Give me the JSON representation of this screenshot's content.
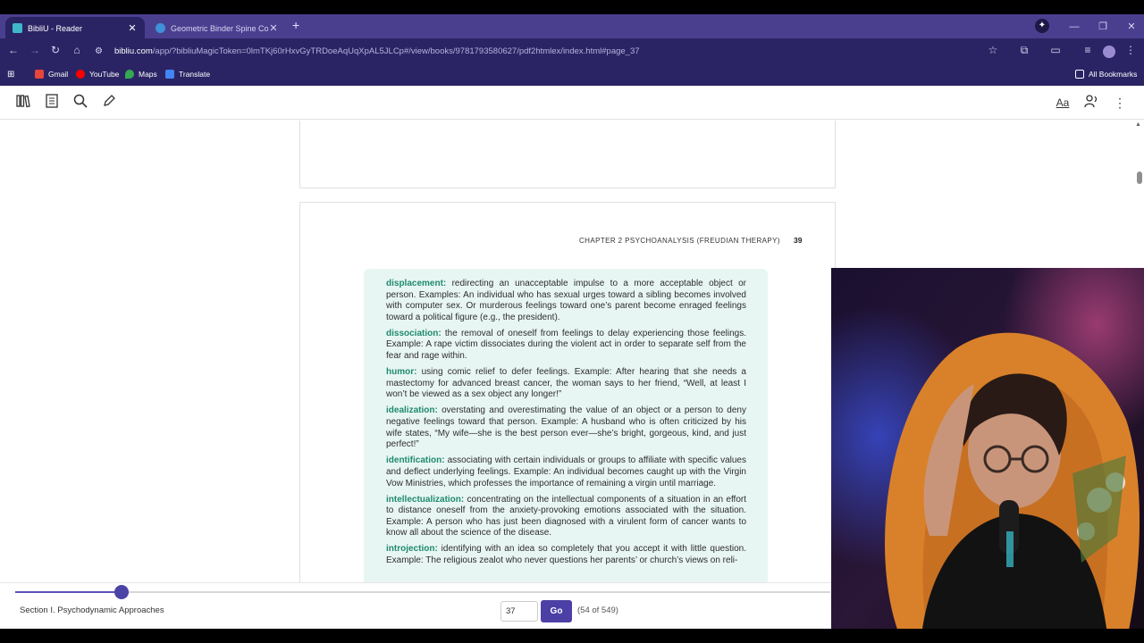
{
  "browser": {
    "tabs": [
      {
        "title": "BibliU - Reader",
        "active": true
      },
      {
        "title": "Geometric Binder Spine Cover",
        "active": false
      }
    ],
    "url_host": "bibliu.com",
    "url_path": "/app/?bibliuMagicToken=0lmTKj60rHxvGyTRDoeAqUqXpAL5JLCp#/view/books/9781793580627/pdf2htmlex/index.html#page_37",
    "bookmarks": [
      "Gmail",
      "YouTube",
      "Maps",
      "Translate"
    ],
    "all_bookmarks": "All Bookmarks"
  },
  "reader": {
    "running_head": "CHAPTER 2  PSYCHOANALYSIS (FREUDIAN THERAPY)",
    "page_number": "39",
    "entries": [
      {
        "term": "displacement:",
        "text": " redirecting an unacceptable impulse to a more acceptable object or person. Examples: An individual who has sexual urges toward a sibling becomes involved with computer sex. Or murderous feelings toward one’s parent become enraged feelings toward a political figure (e.g., the president)."
      },
      {
        "term": "dissociation:",
        "text": " the removal of oneself from feelings to delay experiencing those feelings. Example: A rape victim dissociates during the violent act in order to separate self from the fear and rage within."
      },
      {
        "term": "humor:",
        "text": " using comic relief to defer feelings. Example: After hearing that she needs a mastectomy for advanced breast cancer, the woman says to her friend, “Well, at least I won’t be viewed as a sex object any longer!”"
      },
      {
        "term": "idealization:",
        "text": " overstating and overestimating the value of an object or a person to deny negative feelings toward that person. Example: A husband who is often criticized by his wife states, “My wife—she is the best person ever—she’s bright, gorgeous, kind, and just perfect!”"
      },
      {
        "term": "identification:",
        "text": " associating with certain individuals or groups to affiliate with specific values and deflect underlying feelings. Example: An individual becomes caught up with the Virgin Vow Ministries, which professes the importance of remaining a virgin until marriage."
      },
      {
        "term": "intellectualization:",
        "text": " concentrating on the intellectual components of a situation in an effort to distance oneself from the anxiety-provoking emotions associated with the situation. Example: A person who has just been diagnosed with a virulent form of cancer wants to know all about the science of the disease."
      },
      {
        "term": "introjection:",
        "text": " identifying with an idea so completely that you accept it with little question. Example: The religious zealot who never questions her parents’ or church’s views on reli-"
      }
    ]
  },
  "footer": {
    "section": "Section I. Psychodynamic Approaches",
    "page_input": "37",
    "go_label": "Go",
    "page_count": "(54 of 549)",
    "progress": 0.13
  },
  "colors": {
    "accent": "#4c3fa5",
    "term": "#1f8a6e",
    "callout_bg": "#e8f6f3"
  }
}
